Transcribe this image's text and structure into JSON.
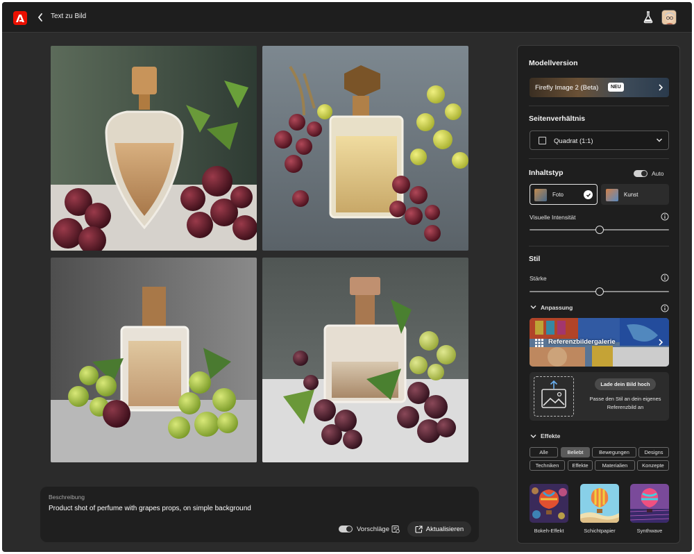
{
  "topbar": {
    "title": "Text zu Bild"
  },
  "prompt": {
    "label": "Beschreibung",
    "text": "Product shot of perfume with grapes props, on  simple background",
    "suggestions_label": "Vorschläge",
    "update_label": "Aktualisieren"
  },
  "panel": {
    "model": {
      "heading": "Modellversion",
      "name": "Firefly Image 2 (Beta)",
      "badge": "NEU"
    },
    "aspect": {
      "heading": "Seitenverhältnis",
      "value": "Quadrat (1:1)"
    },
    "content_type": {
      "heading": "Inhaltstyp",
      "auto_label": "Auto",
      "options": [
        {
          "label": "Foto"
        },
        {
          "label": "Kunst"
        }
      ],
      "selected": "Foto",
      "intensity_label": "Visuelle Intensität",
      "intensity_value": 0.5
    },
    "style": {
      "heading": "Stil",
      "strength_label": "Stärke",
      "strength_value": 0.5,
      "customization_label": "Anpassung",
      "gallery_label": "Referenzbildergalerie",
      "upload_button": "Lade dein Bild hoch",
      "upload_desc": "Passe den Stil an dein eigenes Referenzbild an"
    },
    "effects": {
      "heading": "Effekte",
      "chips": [
        "Alle",
        "Beliebt",
        "Bewegungen",
        "Designs",
        "Techniken",
        "Effekte",
        "Materialien",
        "Konzepte"
      ],
      "active_chip": "Beliebt",
      "thumbnails": [
        {
          "label": "Bokeh-Effekt"
        },
        {
          "label": "Schichtpapier"
        },
        {
          "label": "Synthwave"
        }
      ]
    }
  }
}
